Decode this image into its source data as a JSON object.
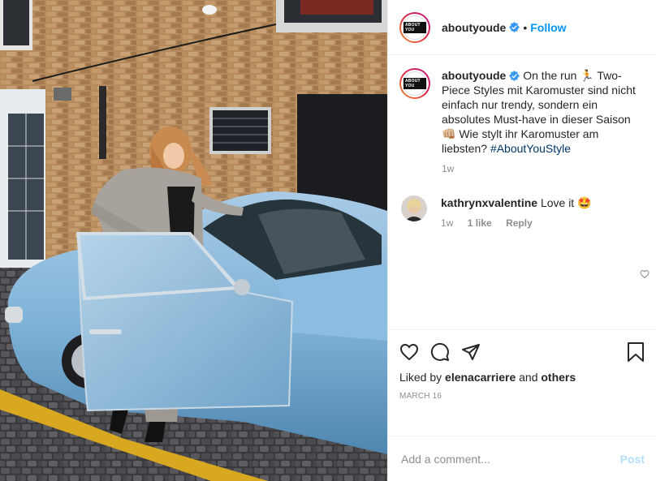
{
  "account": {
    "username": "aboutyoude",
    "logo_text": "ABOUT YOU",
    "separator": "•",
    "follow_label": "Follow"
  },
  "caption": {
    "username": "aboutyoude",
    "text_before_tag": "On the run 🏃 Two-Piece Styles mit Karomuster sind nicht einfach nur trendy, sondern ein absolutes Must-have in dieser Saison 👊🏼 Wie stylt ihr Karomuster am liebsten? ",
    "hashtag": "#AboutYouStyle",
    "age": "1w"
  },
  "comments": [
    {
      "username": "kathrynxvalentine",
      "text": "Love it 🤩",
      "age": "1w",
      "likes": "1 like",
      "reply_label": "Reply"
    }
  ],
  "engagement": {
    "liked_prefix": "Liked by ",
    "liked_user": "elenacarriere",
    "liked_and": " and ",
    "liked_others": "others",
    "date": "MARCH 16"
  },
  "composer": {
    "placeholder": "Add a comment...",
    "post_label": "Post"
  },
  "icons": {
    "like": "heart-icon",
    "comment": "comment-icon",
    "share": "share-icon",
    "save": "bookmark-icon",
    "verified": "verified-badge-icon"
  },
  "colors": {
    "accent": "#0095f6",
    "hashtag": "#00376b",
    "muted": "#8e8e8e",
    "post_disabled": "#b2dffc",
    "car": "#7fb3d8"
  }
}
